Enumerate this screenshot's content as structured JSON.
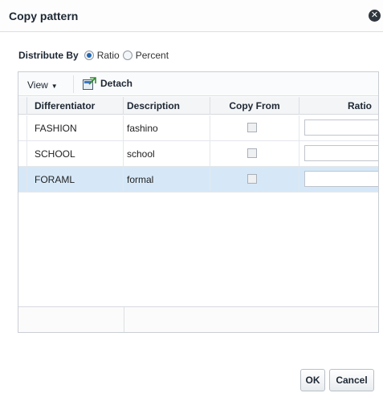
{
  "dialog": {
    "title": "Copy pattern",
    "close_icon": "close-icon"
  },
  "distribute": {
    "label": "Distribute By",
    "options": [
      {
        "label": "Ratio",
        "selected": true
      },
      {
        "label": "Percent",
        "selected": false
      }
    ]
  },
  "toolbar": {
    "view_label": "View",
    "view_caret": "▼",
    "detach_label": "Detach",
    "detach_icon": "detach-icon"
  },
  "table": {
    "columns": [
      "Differentiator",
      "Description",
      "Copy From",
      "Ratio"
    ],
    "rows": [
      {
        "differentiator": "FASHION",
        "description": "fashino",
        "copy_from": false,
        "ratio": "",
        "selected": false
      },
      {
        "differentiator": "SCHOOL",
        "description": "school",
        "copy_from": false,
        "ratio": "",
        "selected": false
      },
      {
        "differentiator": "FORAML",
        "description": "formal",
        "copy_from": false,
        "ratio": "",
        "selected": true
      }
    ]
  },
  "buttons": {
    "ok": "OK",
    "cancel": "Cancel"
  },
  "colors": {
    "selected_row": "#d6e8f8",
    "radio_accent": "#2467b2"
  }
}
